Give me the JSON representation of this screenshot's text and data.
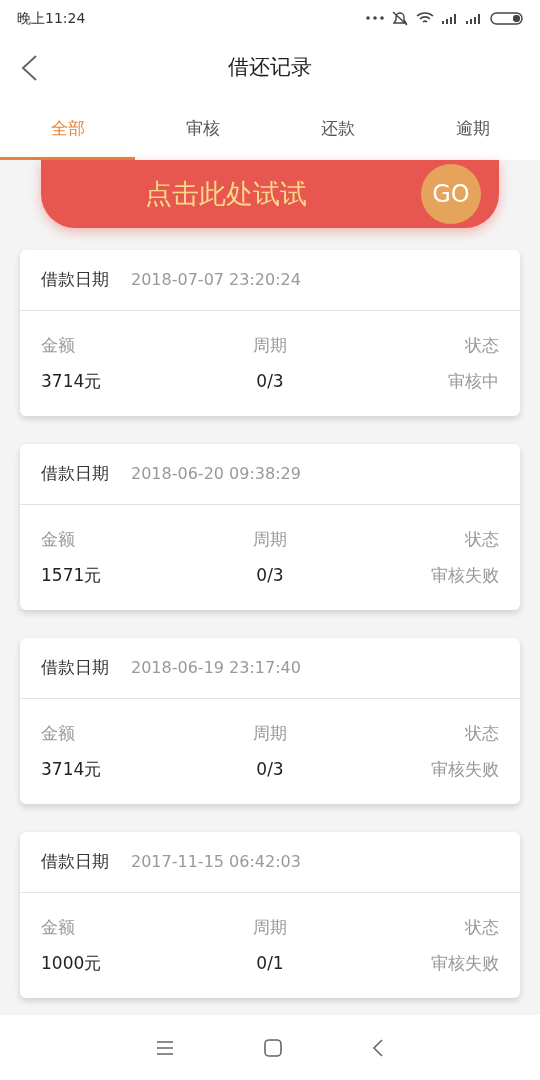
{
  "status_bar": {
    "time": "晚上11:24"
  },
  "header": {
    "title": "借还记录"
  },
  "tabs": [
    {
      "label": "全部",
      "selected": true
    },
    {
      "label": "审核",
      "selected": false
    },
    {
      "label": "还款",
      "selected": false
    },
    {
      "label": "逾期",
      "selected": false
    }
  ],
  "banner": {
    "text": "点击此处试试",
    "button": "GO"
  },
  "records": [
    {
      "date_label": "借款日期",
      "date": "2018-07-07 23:20:24",
      "amount_label": "金额",
      "amount": "3714元",
      "period_label": "周期",
      "period": "0/3",
      "status_label": "状态",
      "status": "审核中"
    },
    {
      "date_label": "借款日期",
      "date": "2018-06-20 09:38:29",
      "amount_label": "金额",
      "amount": "1571元",
      "period_label": "周期",
      "period": "0/3",
      "status_label": "状态",
      "status": "审核失败"
    },
    {
      "date_label": "借款日期",
      "date": "2018-06-19 23:17:40",
      "amount_label": "金额",
      "amount": "3714元",
      "period_label": "周期",
      "period": "0/3",
      "status_label": "状态",
      "status": "审核失败"
    },
    {
      "date_label": "借款日期",
      "date": "2017-11-15 06:42:03",
      "amount_label": "金额",
      "amount": "1000元",
      "period_label": "周期",
      "period": "0/1",
      "status_label": "状态",
      "status": "审核失败"
    }
  ]
}
